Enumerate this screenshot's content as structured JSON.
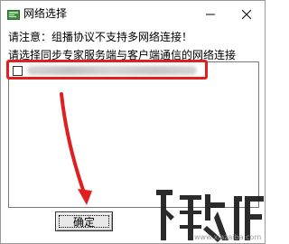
{
  "window": {
    "title": "网络选择",
    "minimize_icon": "minimize-icon",
    "close_icon": "close-icon"
  },
  "notice": "请注意：组播协议不支持多网络连接！",
  "instruction": "请选择同步专家服务端与客户端通信的网络连接",
  "network_list": {
    "items": [
      {
        "checked": false,
        "label": ""
      }
    ]
  },
  "ok_button": "确定",
  "annotation": {
    "highlight_color": "#e02020",
    "arrow_color": "#e02020"
  },
  "watermark": {
    "logo_text": "下载吧",
    "url": "www.xiazaiba.com"
  }
}
